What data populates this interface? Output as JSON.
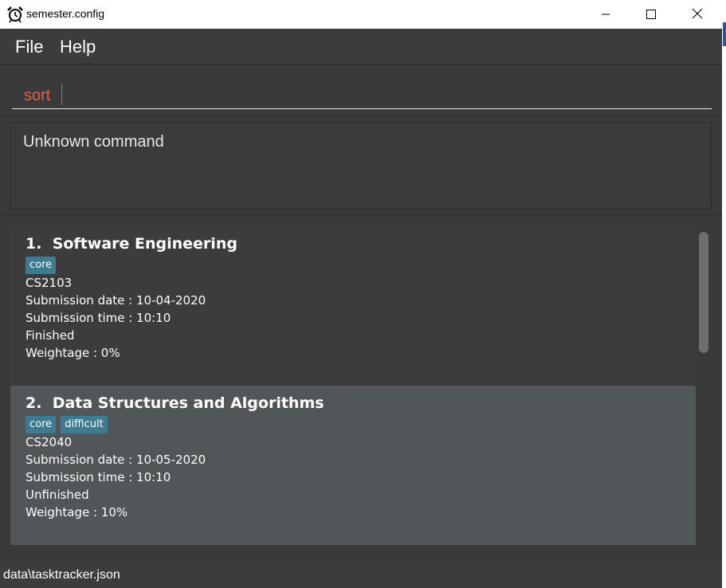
{
  "window": {
    "title": "semester.config",
    "icon": "alarm-clock-icon",
    "controls": [
      "minimize-icon",
      "maximize-icon",
      "close-icon"
    ]
  },
  "menu": {
    "file_label": "File",
    "help_label": "Help"
  },
  "command_box": {
    "value": "sort"
  },
  "result_display": {
    "text": "Unknown command"
  },
  "task_list": {
    "items": [
      {
        "index": "1.",
        "name": "Software Engineering",
        "tags": [
          "core"
        ],
        "code": "CS2103",
        "submission_date": "Submission date : 10-04-2020",
        "submission_time": "Submission time : 10:10",
        "status": "Finished",
        "weightage": "Weightage : 0%"
      },
      {
        "index": "2.",
        "name": "Data Structures and Algorithms",
        "tags": [
          "core",
          "difficult"
        ],
        "code": "CS2040",
        "submission_date": "Submission date : 10-05-2020",
        "submission_time": "Submission time : 10:10",
        "status": "Unfinished",
        "weightage": "Weightage : 10%"
      }
    ]
  },
  "status_bar": {
    "file_path": "data\\tasktracker.json"
  },
  "colors": {
    "background": "#3a3a3a",
    "selected_card": "#515658",
    "tag": "#3e7b91",
    "command_text": "#e0624a"
  }
}
